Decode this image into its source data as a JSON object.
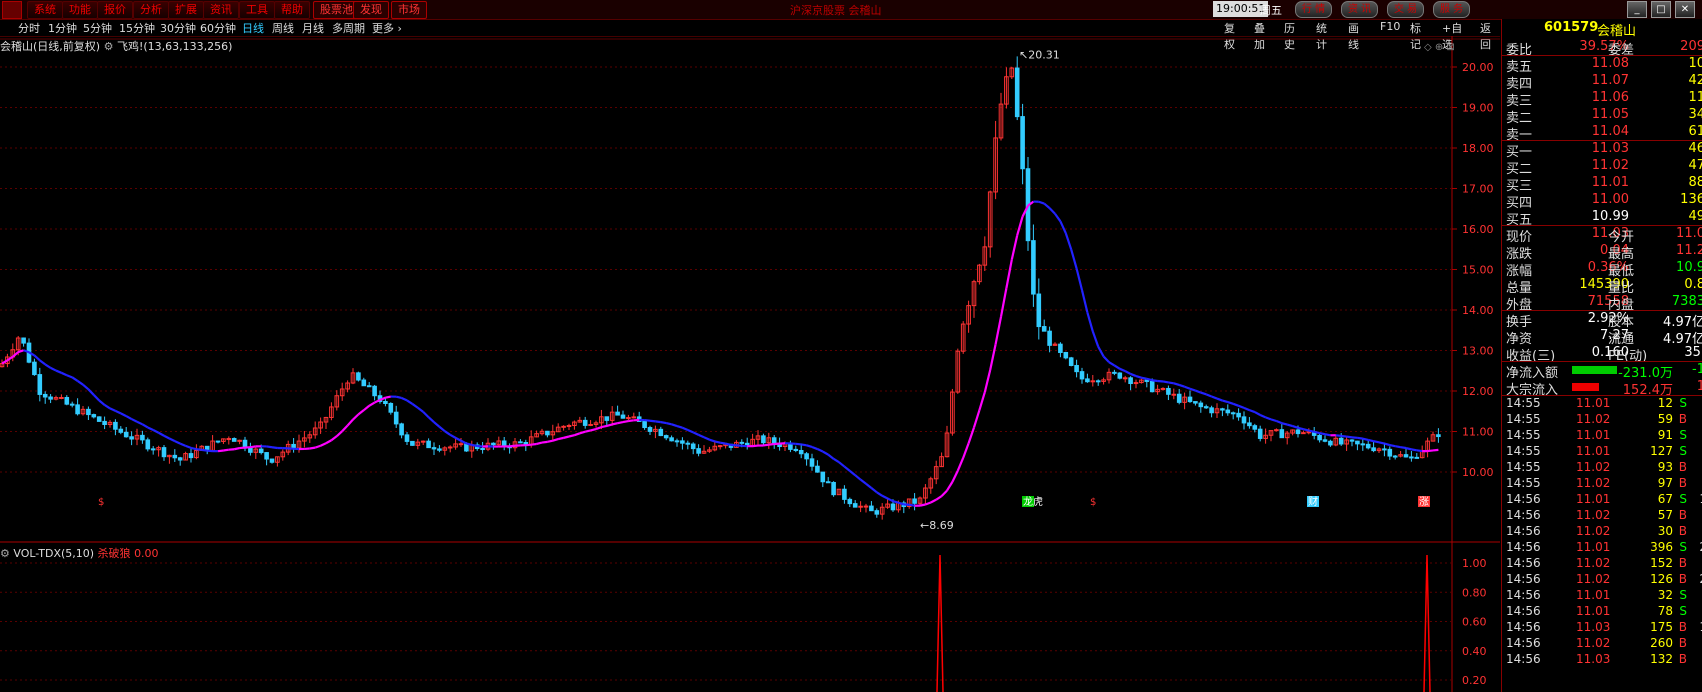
{
  "menu": [
    "系统",
    "功能",
    "报价",
    "分析",
    "扩展",
    "资讯",
    "工具",
    "帮助",
    "股票池",
    "发现",
    "市场"
  ],
  "window_title": "沪深京股票 会稽山",
  "clock": "19:00:51",
  "weekday": "周五",
  "top_buttons": [
    "行 情",
    "资 讯",
    "交 易",
    "服 务"
  ],
  "periods": [
    "分时",
    "1分钟",
    "5分钟",
    "15分钟",
    "30分钟",
    "60分钟",
    "日线",
    "周线",
    "月线",
    "多周期",
    "更多"
  ],
  "active_period": "日线",
  "tools": [
    "复权",
    "叠加",
    "历史",
    "统计",
    "画线",
    "F10",
    "标记",
    "+自选",
    "返回"
  ],
  "chart_info": {
    "name": "会稽山(日线,前复权)",
    "indicator": "飞鸡!(13,63,133,256)"
  },
  "volume_info": {
    "name": "VOL-TDX(5,10)",
    "label": "杀破狼",
    "value": "0.00"
  },
  "annotations": {
    "high": "20.31",
    "low": "8.69",
    "marks": [
      "$",
      "$",
      "财",
      "涨",
      "龙虎"
    ]
  },
  "price_axis": [
    "20.00",
    "19.00",
    "18.00",
    "17.00",
    "16.00",
    "15.00",
    "14.00",
    "13.00",
    "12.00",
    "11.00",
    "10.00"
  ],
  "vol_axis": [
    "1.00",
    "0.80",
    "0.60",
    "0.40",
    "0.20"
  ],
  "stock": {
    "code": "601579",
    "name": "会稽山"
  },
  "weibi": {
    "label": "委比",
    "value": "39.57%",
    "label2": "委差",
    "value2": "209"
  },
  "asks": [
    {
      "label": "卖五",
      "price": "11.08",
      "vol": "10"
    },
    {
      "label": "卖四",
      "price": "11.07",
      "vol": "42"
    },
    {
      "label": "卖三",
      "price": "11.06",
      "vol": "11"
    },
    {
      "label": "卖二",
      "price": "11.05",
      "vol": "34"
    },
    {
      "label": "卖一",
      "price": "11.04",
      "vol": "61"
    }
  ],
  "bids": [
    {
      "label": "买一",
      "price": "11.03",
      "vol": "46"
    },
    {
      "label": "买二",
      "price": "11.02",
      "vol": "47"
    },
    {
      "label": "买三",
      "price": "11.01",
      "vol": "88"
    },
    {
      "label": "买四",
      "price": "11.00",
      "vol": "136"
    },
    {
      "label": "买五",
      "price": "10.99",
      "vol": "49"
    }
  ],
  "stats": [
    {
      "l": "现价",
      "v": "11.03",
      "l2": "今开",
      "v2": "11.0",
      "c": "red",
      "c2": "red"
    },
    {
      "l": "涨跌",
      "v": "0.04",
      "l2": "最高",
      "v2": "11.2",
      "c": "red",
      "c2": "red"
    },
    {
      "l": "涨幅",
      "v": "0.36%",
      "l2": "最低",
      "v2": "10.9",
      "c": "red",
      "c2": "grn"
    },
    {
      "l": "总量",
      "v": "145390",
      "l2": "量比",
      "v2": "0.8",
      "c": "yel",
      "c2": "yel"
    },
    {
      "l": "外盘",
      "v": "71558",
      "l2": "内盘",
      "v2": "7383",
      "c": "red",
      "c2": "grn"
    }
  ],
  "stats2": [
    {
      "l": "换手",
      "v": "2.92%",
      "l2": "股本",
      "v2": "4.97亿"
    },
    {
      "l": "净资",
      "v": "7.27",
      "l2": "流通",
      "v2": "4.97亿"
    },
    {
      "l": "收益(三)",
      "v": "0.160",
      "l2": "PE(动)",
      "v2": "35."
    }
  ],
  "flows": [
    {
      "l": "净流入额",
      "v": "-231.0万",
      "v2": "-1",
      "bar": "#0c0",
      "barw": 0.75
    },
    {
      "l": "大宗流入",
      "v": "152.4万",
      "v2": "1",
      "bar": "#e00",
      "barw": 0.45
    }
  ],
  "ticks": [
    {
      "t": "14:55",
      "p": "11.01",
      "q": "12",
      "s": "S",
      "n": ""
    },
    {
      "t": "14:55",
      "p": "11.02",
      "q": "59",
      "s": "B",
      "n": ""
    },
    {
      "t": "14:55",
      "p": "11.01",
      "q": "91",
      "s": "S",
      "n": ""
    },
    {
      "t": "14:55",
      "p": "11.01",
      "q": "127",
      "s": "S",
      "n": ""
    },
    {
      "t": "14:55",
      "p": "11.02",
      "q": "93",
      "s": "B",
      "n": ""
    },
    {
      "t": "14:55",
      "p": "11.02",
      "q": "97",
      "s": "B",
      "n": ""
    },
    {
      "t": "14:56",
      "p": "11.01",
      "q": "67",
      "s": "S",
      "n": "1"
    },
    {
      "t": "14:56",
      "p": "11.02",
      "q": "57",
      "s": "B",
      "n": ""
    },
    {
      "t": "14:56",
      "p": "11.02",
      "q": "30",
      "s": "B",
      "n": ""
    },
    {
      "t": "14:56",
      "p": "11.01",
      "q": "396",
      "s": "S",
      "n": "2"
    },
    {
      "t": "14:56",
      "p": "11.02",
      "q": "152",
      "s": "B",
      "n": ""
    },
    {
      "t": "14:56",
      "p": "11.02",
      "q": "126",
      "s": "B",
      "n": "2"
    },
    {
      "t": "14:56",
      "p": "11.01",
      "q": "32",
      "s": "S",
      "n": ""
    },
    {
      "t": "14:56",
      "p": "11.01",
      "q": "78",
      "s": "S",
      "n": ""
    },
    {
      "t": "14:56",
      "p": "11.03",
      "q": "175",
      "s": "B",
      "n": "1"
    },
    {
      "t": "14:56",
      "p": "11.02",
      "q": "260",
      "s": "B",
      "n": ""
    },
    {
      "t": "14:56",
      "p": "11.03",
      "q": "132",
      "s": "B",
      "n": ""
    }
  ],
  "colors": {
    "up": "#ff3333",
    "down": "#33ccff",
    "ma_up": "#ff00ff",
    "ma_down": "#2222ff",
    "grid": "#5a0000",
    "vol": "#ff0000"
  }
}
